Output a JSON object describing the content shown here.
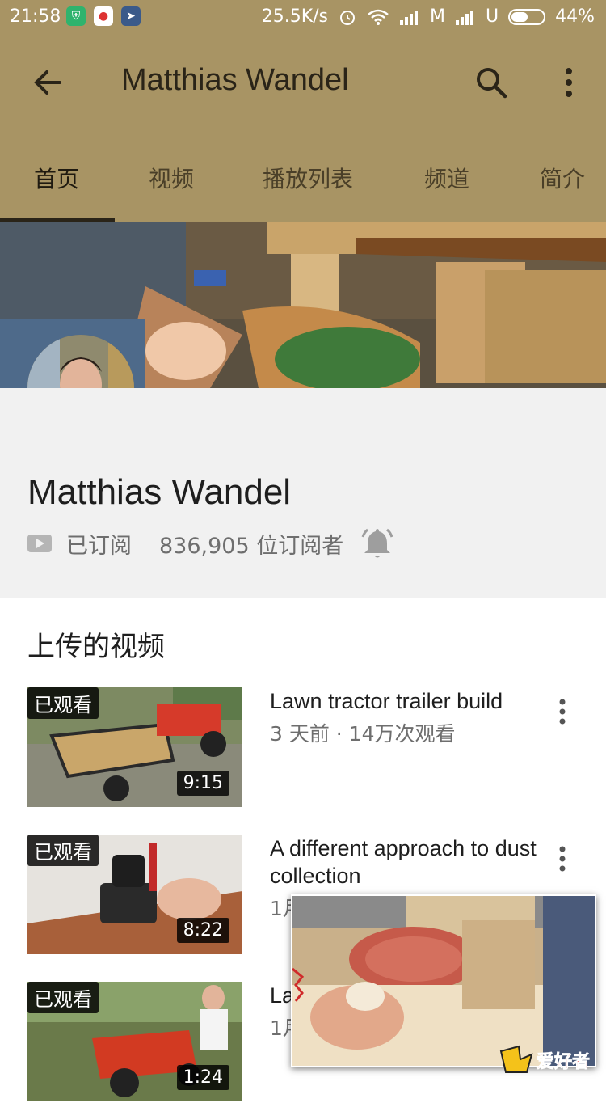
{
  "status_bar": {
    "time": "21:58",
    "speed": "25.5K/s",
    "carrier1": "M",
    "carrier2": "U",
    "battery": "44%",
    "battery_level": 0.44,
    "icons": [
      "shield-app-icon",
      "maps-app-icon",
      "telegram-app-icon",
      "alarm-icon",
      "wifi-icon",
      "signal-icon",
      "signal-icon",
      "battery-icon"
    ]
  },
  "app_bar": {
    "title": "Matthias Wandel",
    "back_icon": "arrow-left-icon",
    "search_icon": "search-icon",
    "more_icon": "more-vertical-icon",
    "background": "#a89464"
  },
  "tabs": [
    {
      "label": "首页",
      "active": true
    },
    {
      "label": "视频",
      "active": false
    },
    {
      "label": "播放列表",
      "active": false
    },
    {
      "label": "频道",
      "active": false
    },
    {
      "label": "简介",
      "active": false
    }
  ],
  "channel": {
    "name": "Matthias Wandel",
    "subscribed_label": "已订阅",
    "subscribers": "836,905 位订阅者",
    "bell_icon": "notification-bell-icon"
  },
  "uploads": {
    "section_title": "上传的视频",
    "videos": [
      {
        "title": "Lawn tractor trailer build",
        "meta": "3 天前 · 14万次观看",
        "duration": "9:15",
        "watched": "已观看"
      },
      {
        "title": "A different approach to dust collection",
        "meta": "1月",
        "duration": "8:22",
        "watched": "已观看"
      },
      {
        "title": "La",
        "meta": "1月",
        "duration": "1:24",
        "watched": "已观看"
      }
    ]
  },
  "watermark": "爱好者"
}
